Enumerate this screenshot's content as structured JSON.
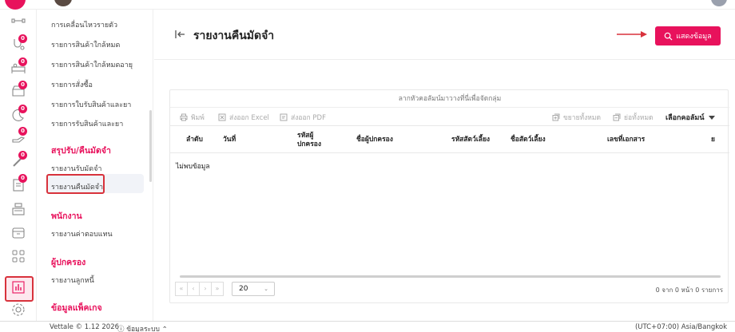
{
  "topbar": {
    "logo": "vettale-heart-logo",
    "avatar": "user-avatar"
  },
  "rail": {
    "icons": [
      {
        "name": "dumbbell-icon",
        "badge": ""
      },
      {
        "name": "stethoscope-icon",
        "badge": "0"
      },
      {
        "name": "bed-icon",
        "badge": "0"
      },
      {
        "name": "tray-icon",
        "badge": "0"
      },
      {
        "name": "moon-icon",
        "badge": "0"
      },
      {
        "name": "hand-icon",
        "badge": "0"
      },
      {
        "name": "syringe-icon",
        "badge": "0"
      },
      {
        "name": "clipboard-icon",
        "badge": "0"
      },
      {
        "name": "register-icon",
        "badge": ""
      },
      {
        "name": "box-icon",
        "badge": ""
      },
      {
        "name": "grid-icon",
        "badge": ""
      },
      {
        "name": "chart-icon",
        "badge": ""
      },
      {
        "name": "gear-icon",
        "badge": ""
      }
    ]
  },
  "menu": {
    "items": [
      {
        "label": "การเคลื่อนไหวรายตัว",
        "type": "item"
      },
      {
        "label": "รายการสินค้าใกล้หมด",
        "type": "item"
      },
      {
        "label": "รายการสินค้าใกล้หมดอายุ",
        "type": "item"
      },
      {
        "label": "รายการสั่งซื้อ",
        "type": "item"
      },
      {
        "label": "รายการใบรับสินค้าและยา",
        "type": "item"
      },
      {
        "label": "รายการรับสินค้าและยา",
        "type": "item"
      },
      {
        "label": "สรุปรับ/คืนมัดจำ",
        "type": "section"
      },
      {
        "label": "รายงานรับมัดจำ",
        "type": "item"
      },
      {
        "label": "รายงานคืนมัดจำ",
        "type": "item"
      },
      {
        "label": "พนักงาน",
        "type": "section"
      },
      {
        "label": "รายงานค่าตอบแทน",
        "type": "item"
      },
      {
        "label": "ผู้ปกครอง",
        "type": "section"
      },
      {
        "label": "รายงานลูกหนี้",
        "type": "item"
      },
      {
        "label": "ข้อมูลแพ็คเกจ",
        "type": "section"
      }
    ]
  },
  "header": {
    "title": "รายงานคืนมัดจำ",
    "show_button": "แสดงข้อมูล"
  },
  "grid": {
    "group_hint": "ลากหัวคอลัมน์มาวางที่นี่เพื่อจัดกลุ่ม",
    "toolbar": {
      "print": "พิมพ์",
      "export_excel": "ส่งออก Excel",
      "export_pdf": "ส่งออก PDF",
      "expand_all": "ขยายทั้งหมด",
      "collapse_all": "ย่อทั้งหมด",
      "column_chooser": "เลือกคอลัมน์"
    },
    "columns": [
      "ลำดับ",
      "วันที่",
      "รหัสผู้ปกครอง",
      "ชื่อผู้ปกครอง",
      "รหัสสัตว์เลี้ยง",
      "ชื่อสัตว์เลี้ยง",
      "เลขที่เอกสาร",
      "ย"
    ],
    "empty_text": "ไม่พบข้อมูล",
    "pager": {
      "first": "«",
      "prev": "‹",
      "next": "›",
      "last": "»",
      "page_size": "20",
      "info": "0 จาก 0 หน้า 0 รายการ"
    }
  },
  "footer": {
    "version": "Vettale © 1.12 2026",
    "system_info": "ข้อมูลระบบ",
    "timezone": "(UTC+07:00) Asia/Bangkok"
  },
  "colors": {
    "accent": "#e8125c",
    "highlight_box": "#d8323c"
  }
}
